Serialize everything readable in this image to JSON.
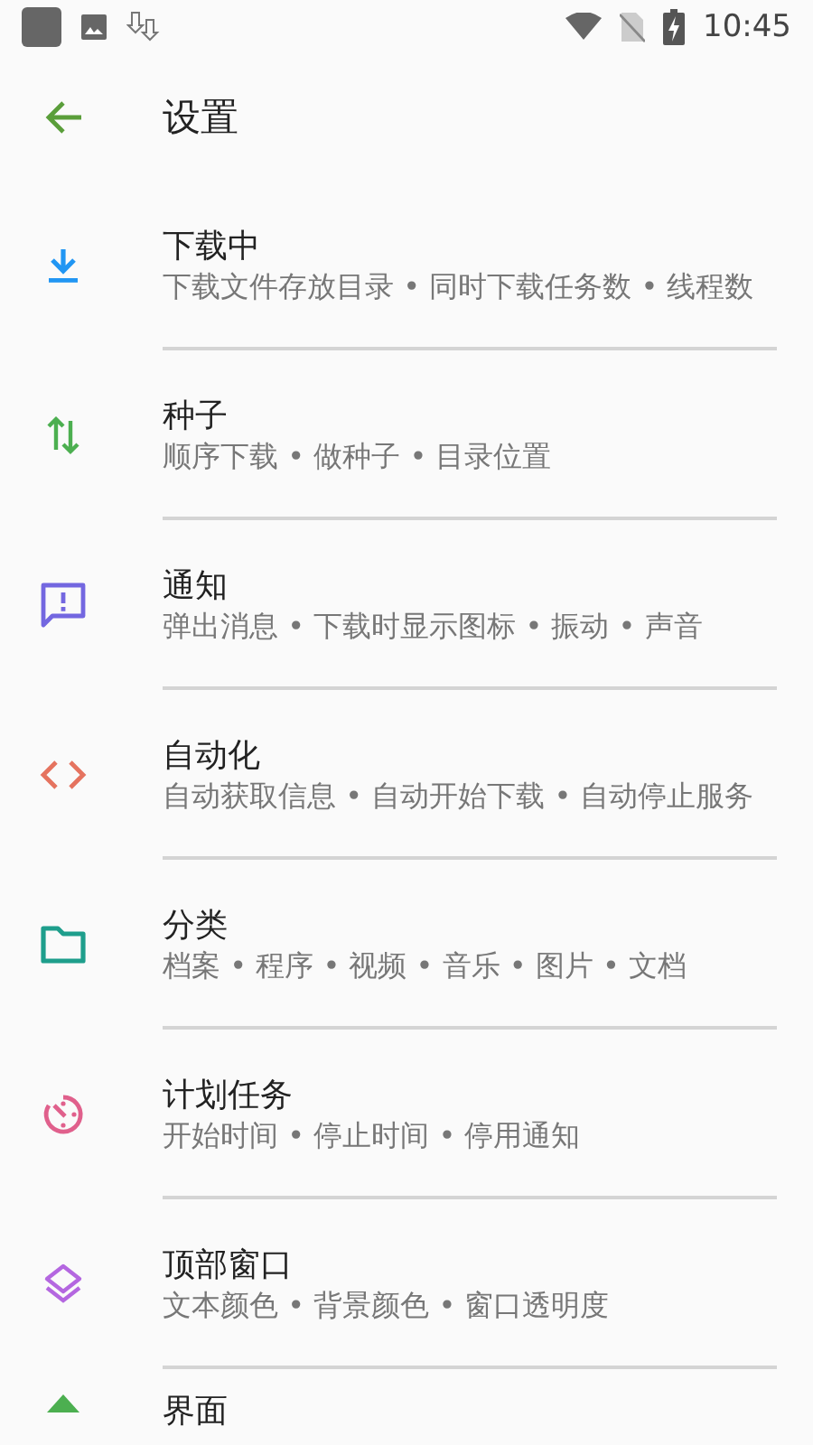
{
  "status_bar": {
    "time": "10:45"
  },
  "header": {
    "title": "设置"
  },
  "items": [
    {
      "color": "#2196f3",
      "title": "下载中",
      "subtitle": "下载文件存放目录 • 同时下载任务数 • 线程数"
    },
    {
      "color": "#4caf50",
      "title": "种子",
      "subtitle": "顺序下载 • 做种子 • 目录位置"
    },
    {
      "color": "#7367e0",
      "title": "通知",
      "subtitle": "弹出消息 • 下载时显示图标 • 振动 • 声音"
    },
    {
      "color": "#e5735f",
      "title": "自动化",
      "subtitle": "自动获取信息 • 自动开始下载 • 自动停止服务"
    },
    {
      "color": "#1e9e8c",
      "title": "分类",
      "subtitle": "档案 • 程序 • 视频 • 音乐 • 图片 • 文档"
    },
    {
      "color": "#e0608c",
      "title": "计划任务",
      "subtitle": "开始时间 • 停止时间 • 停用通知"
    },
    {
      "color": "#b467e0",
      "title": "顶部窗口",
      "subtitle": "文本颜色 • 背景颜色 • 窗口透明度"
    },
    {
      "color": "#4caf50",
      "title": "界面"
    }
  ]
}
